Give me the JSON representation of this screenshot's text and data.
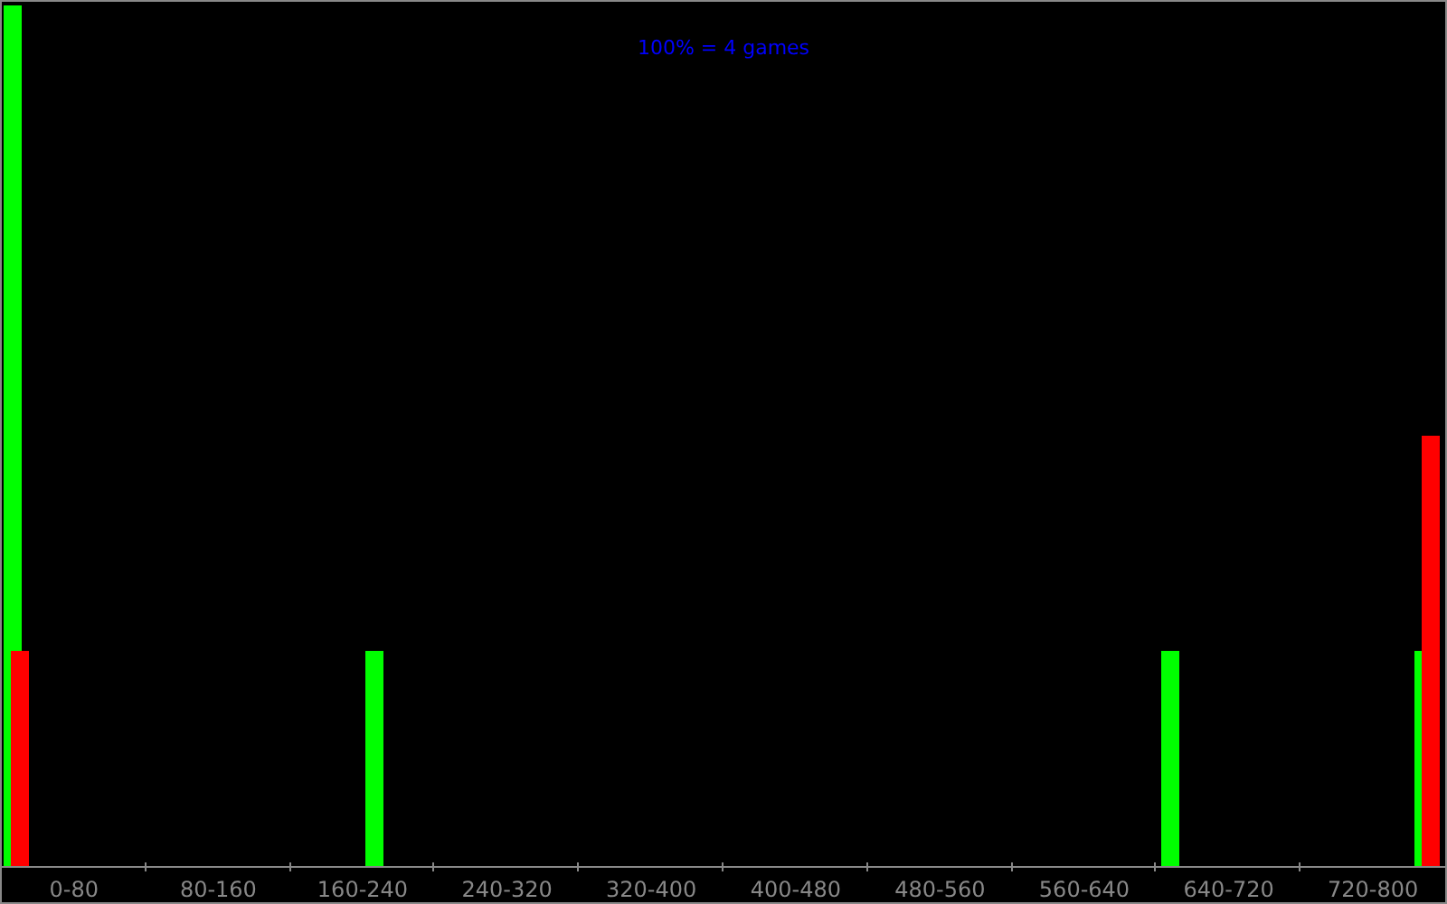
{
  "chart": {
    "title": "100% = 4 games",
    "axis_labels": [
      "0-80",
      "80-160",
      "160-240",
      "240-320",
      "320-400",
      "400-480",
      "480-560",
      "560-640",
      "640-720",
      "720-800"
    ]
  }
}
